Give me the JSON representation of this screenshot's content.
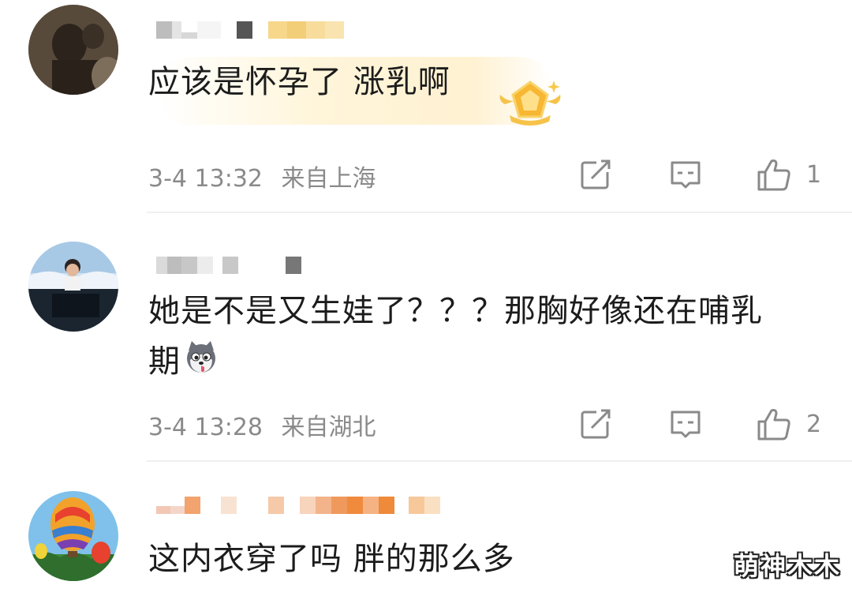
{
  "comments": [
    {
      "text": "应该是怀孕了 涨乳啊",
      "time": "3-4 13:32",
      "location": "来自上海",
      "likes": "1",
      "badge_icon": "gold-pentagon-badge-icon"
    },
    {
      "text": "她是不是又生娃了？？？那胸好像还在哺乳",
      "text_line2": "期",
      "emoji": "husky-dog-emoji-icon",
      "time": "3-4 13:28",
      "location": "来自湖北",
      "likes": "2"
    },
    {
      "text": "这内衣穿了吗 胖的那么多"
    }
  ],
  "watermark": "萌神木木",
  "icons": {
    "share": "share-icon",
    "reply": "comment-icon",
    "like": "thumbs-up-icon"
  },
  "colors": {
    "meta": "#8a8a8a",
    "text": "#1c1c1c",
    "divider": "#efefef",
    "badge": "#f7b733"
  }
}
